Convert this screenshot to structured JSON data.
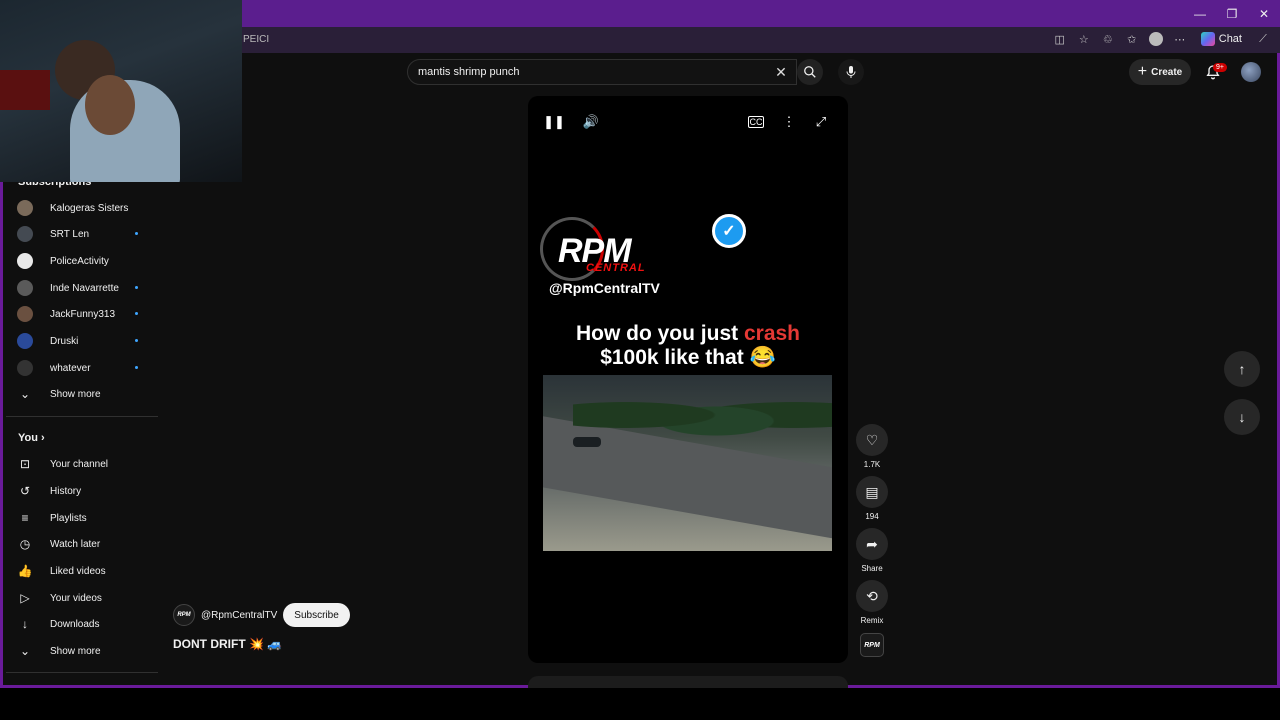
{
  "browser": {
    "tab_fragment": "PEICI",
    "chat_label": "Chat",
    "win_controls": [
      "—",
      "❐",
      "✕"
    ]
  },
  "header": {
    "search_query": "mantis shrimp punch",
    "create_label": "Create",
    "notification_badge": "9+"
  },
  "sidebar": {
    "subscriptions_title": "Subscriptions",
    "subscriptions": [
      {
        "label": "Kalogeras Sisters",
        "dot": false,
        "color": "#7a6a5a"
      },
      {
        "label": "SRT Len",
        "dot": true,
        "color": "#444a52"
      },
      {
        "label": "PoliceActivity",
        "dot": false,
        "color": "#e8e8e8"
      },
      {
        "label": "Inde Navarrette",
        "dot": true,
        "color": "#5a5a5a"
      },
      {
        "label": "JackFunny313",
        "dot": true,
        "color": "#6a5040"
      },
      {
        "label": "Druski",
        "dot": true,
        "color": "#2a4a9a"
      },
      {
        "label": "whatever",
        "dot": true,
        "color": "#333333"
      }
    ],
    "show_more_1": "Show more",
    "you_title": "You",
    "you_items": [
      {
        "label": "Your channel",
        "icon": "channel-icon"
      },
      {
        "label": "History",
        "icon": "history-icon"
      },
      {
        "label": "Playlists",
        "icon": "playlists-icon"
      },
      {
        "label": "Watch later",
        "icon": "watch-later-icon"
      },
      {
        "label": "Liked videos",
        "icon": "liked-icon"
      },
      {
        "label": "Your videos",
        "icon": "your-videos-icon"
      },
      {
        "label": "Downloads",
        "icon": "downloads-icon"
      }
    ],
    "show_more_2": "Show more"
  },
  "video": {
    "logo_text": "RPM",
    "logo_sub": "CENTRAL",
    "overlay_handle": "@RpmCentralTV",
    "caption_part1": "How do you just ",
    "caption_red": "crash",
    "caption_part2": "$100k like that 😂"
  },
  "actions": {
    "likes": "1.7K",
    "comments": "194",
    "share": "Share",
    "remix": "Remix"
  },
  "meta": {
    "avatar_text": "RPM",
    "channel_handle": "@RpmCentralTV",
    "subscribe_label": "Subscribe",
    "title": "DONT DRIFT 💥 🚙"
  },
  "colors": {
    "accent_purple": "#6a1b9a",
    "caption_red": "#e53935",
    "verified_blue": "#1d9bf0"
  }
}
